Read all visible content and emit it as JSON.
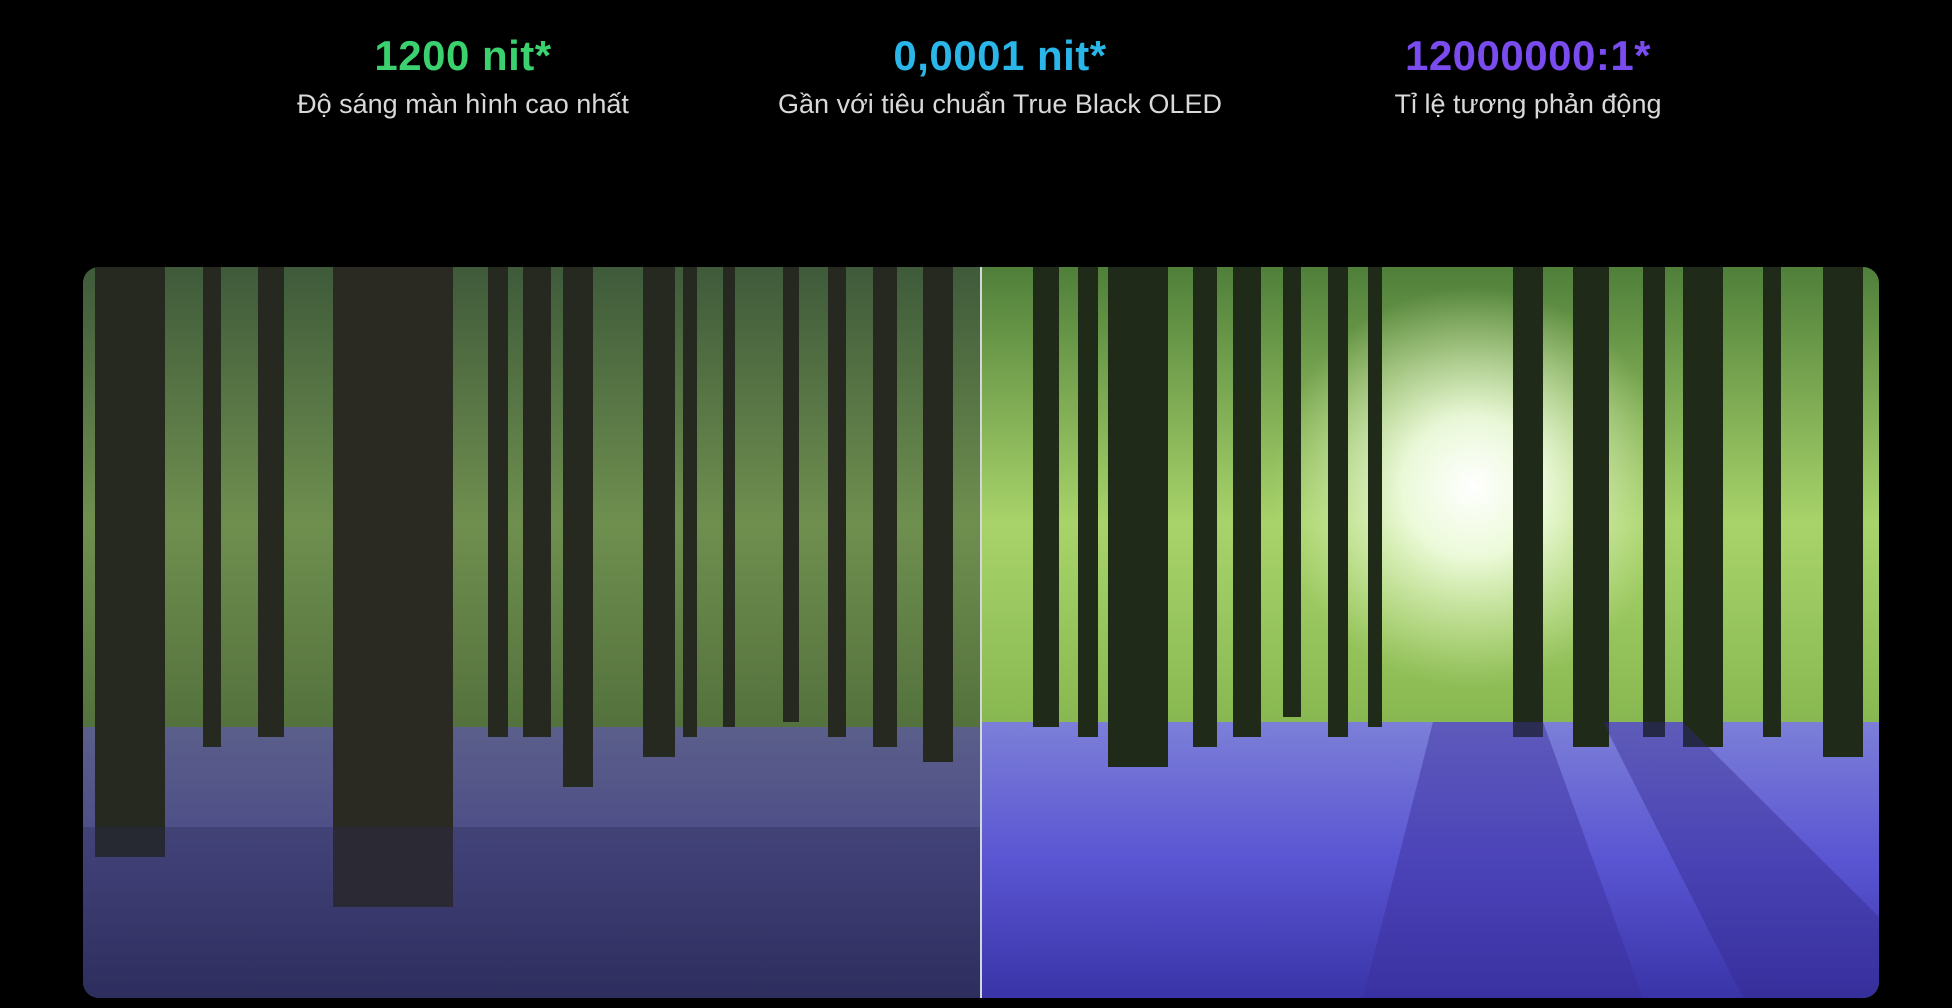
{
  "stats": [
    {
      "value": "1200 nit*",
      "label": "Độ sáng màn hình cao nhất"
    },
    {
      "value": "0,0001 nit*",
      "label": "Gần với tiêu chuẩn True Black OLED"
    },
    {
      "value": "12000000:1*",
      "label": "Tỉ lệ tương phản động"
    }
  ],
  "colors": {
    "background": "#000000",
    "stat1": "#3bd16f",
    "stat2": "#2ab6e8",
    "stat3": "#7a4cf0",
    "label": "#d9d9d9"
  },
  "comparison_image": {
    "subject": "bluebell forest",
    "left_panel": "standard",
    "right_panel": "enhanced"
  }
}
